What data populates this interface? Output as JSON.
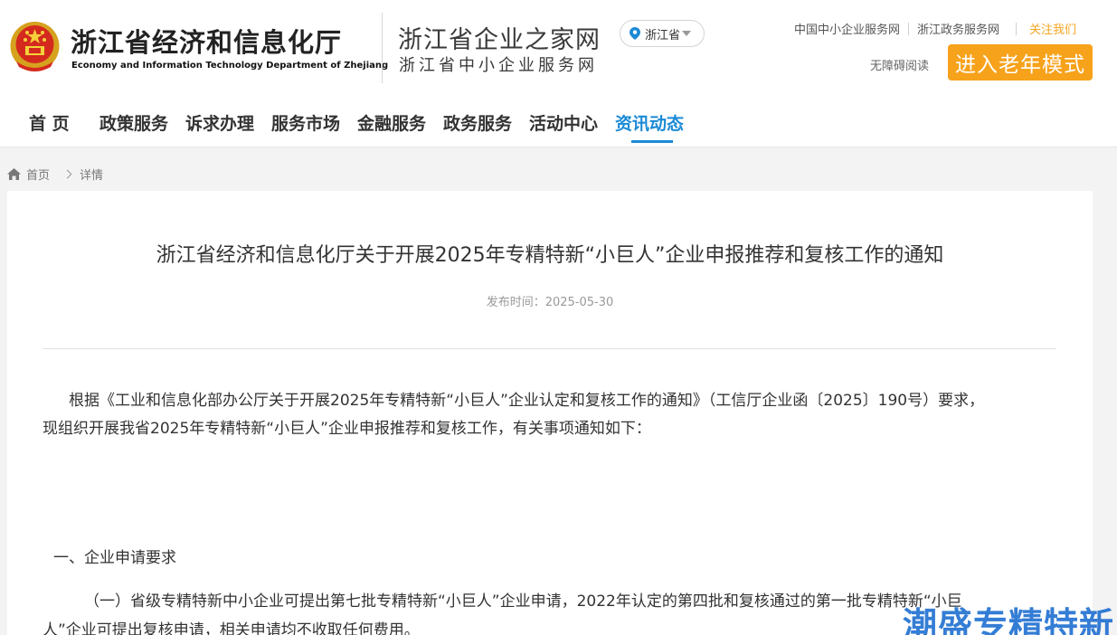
{
  "header": {
    "dept_name_cn": "浙江省经济和信息化厅",
    "dept_name_en": "Economy and Information Technology Department of Zhejiang",
    "site_name": "浙江省企业之家网",
    "site_subtitle": "浙江省中小企业服务网",
    "region": "浙江省",
    "links": [
      "中国中小企业服务网",
      "浙江政务服务网"
    ],
    "follow_label": "关注我们",
    "accessibility_label": "无障碍阅读",
    "elder_mode_label": "进入老年模式",
    "accent_color": "#f7a21b"
  },
  "nav": {
    "items": [
      "首 页",
      "政策服务",
      "诉求办理",
      "服务市场",
      "金融服务",
      "政务服务",
      "活动中心",
      "资讯动态"
    ],
    "active": "资讯动态",
    "active_color": "#1b8ad6"
  },
  "breadcrumb": {
    "home": "首页",
    "current": "详情"
  },
  "article": {
    "title": "浙江省经济和信息化厅关于开展2025年专精特新“小巨人”企业申报推荐和复核工作的通知",
    "published": "发布时间：2025-05-30",
    "para1_line1": "根据《工业和信息化部办公厅关于开展2025年专精特新“小巨人”企业认定和复核工作的通知》（工信厅企业函〔2025〕190号）要求，",
    "para1_line2": "现组织开展我省2025年专精特新“小巨人”企业申报推荐和复核工作，有关事项通知如下：",
    "section1": "一、企业申请要求",
    "para2_line1": "（一）省级专精特新中小企业可提出第七批专精特新“小巨人”企业申请，2022年认定的第四批和复核通过的第一批专精特新“小巨",
    "para2_line2": "人”企业可提出复核申请，相关申请均不收取任何费用。"
  },
  "watermark": "潮盛专精特新"
}
